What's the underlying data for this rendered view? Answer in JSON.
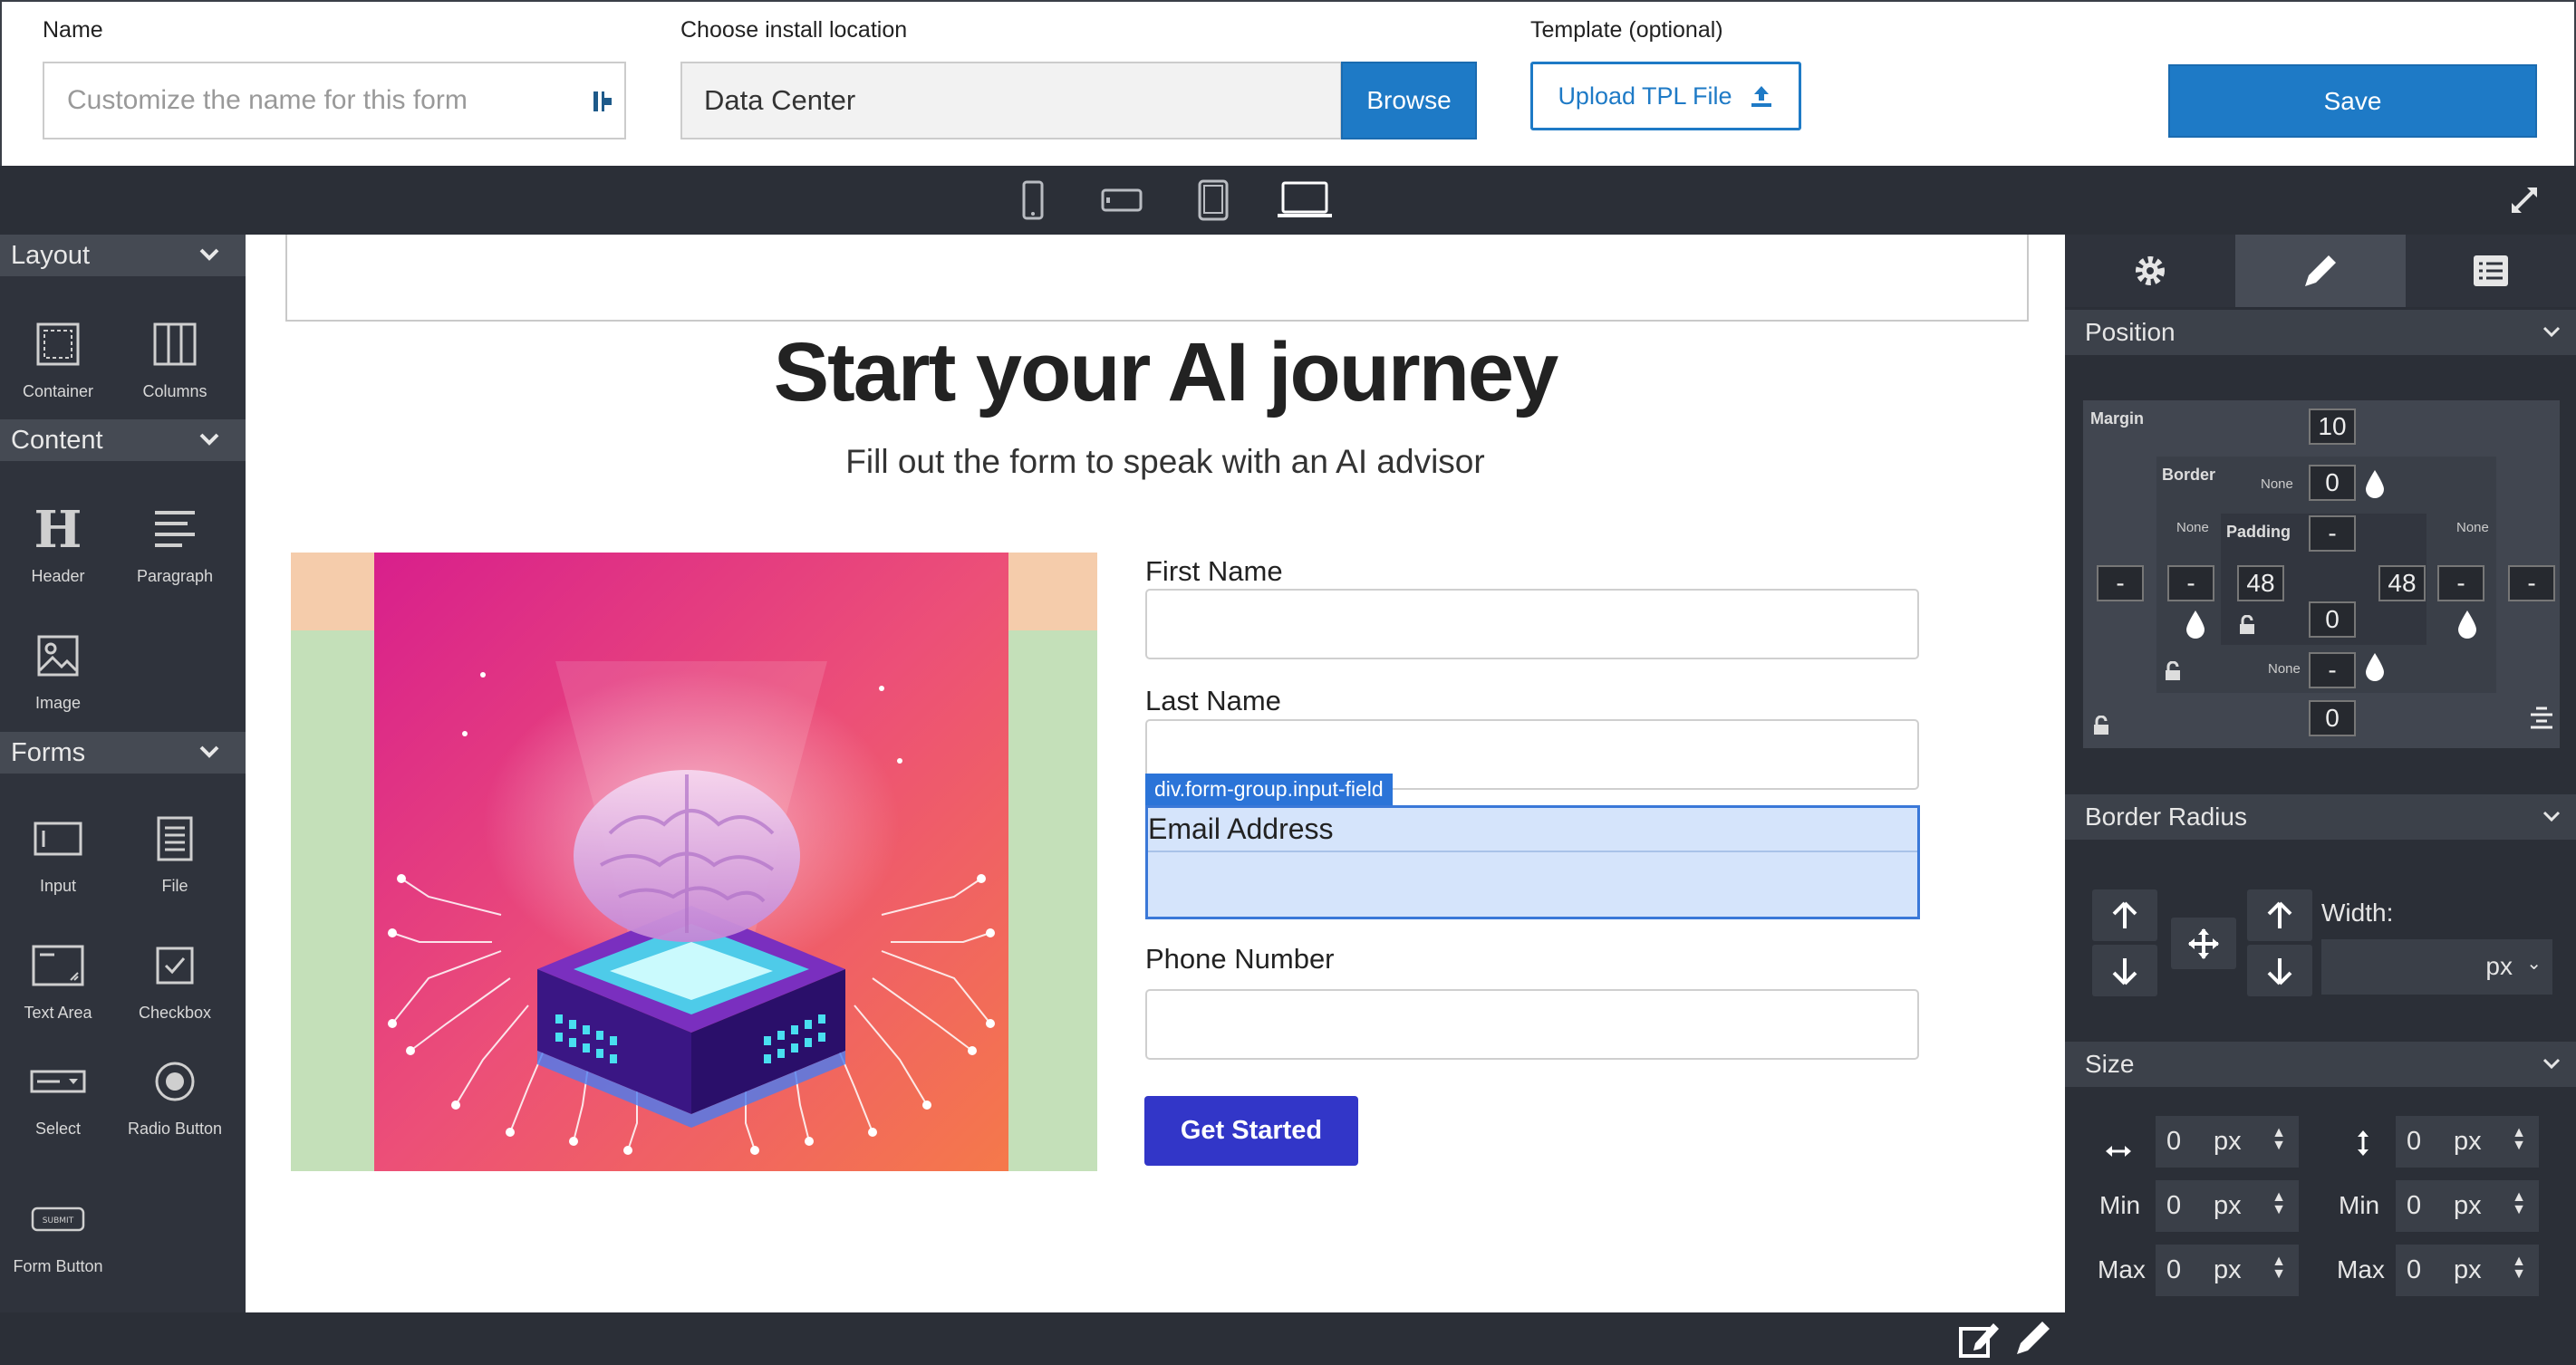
{
  "header": {
    "name_label": "Name",
    "name_placeholder": "Customize the name for this form",
    "location_label": "Choose install location",
    "location_value": "Data Center",
    "browse_label": "Browse",
    "template_label": "Template (optional)",
    "upload_label": "Upload TPL File",
    "save_label": "Save"
  },
  "sidebar": {
    "layout": {
      "title": "Layout",
      "items": [
        "Container",
        "Columns"
      ]
    },
    "content": {
      "title": "Content",
      "items": [
        "Header",
        "Paragraph",
        "Image"
      ]
    },
    "forms": {
      "title": "Forms",
      "items": [
        "Input",
        "File",
        "Text Area",
        "Checkbox",
        "Select",
        "Radio Button",
        "Form Button"
      ]
    }
  },
  "canvas": {
    "title": "Start your AI journey",
    "subtitle": "Fill out the form to speak with an AI advisor",
    "fields": [
      "First Name",
      "Last Name",
      "Email Address",
      "Phone Number"
    ],
    "selected_tag": "div.form-group.input-field",
    "cta_label": "Get Started"
  },
  "right_panel": {
    "position": {
      "title": "Position",
      "margin_label": "Margin",
      "border_label": "Border",
      "padding_label": "Padding",
      "none_label": "None",
      "margin_top": "10",
      "margin_bottom": "0",
      "margin_left": "-",
      "margin_right": "-",
      "border_top": "0",
      "border_bottom": "-",
      "border_left": "-",
      "border_right": "-",
      "padding_top": "-",
      "padding_bottom": "0",
      "padding_left": "48",
      "padding_right": "48"
    },
    "border_radius": {
      "title": "Border Radius",
      "width_label": "Width:",
      "unit": "px"
    },
    "size": {
      "title": "Size",
      "min_label": "Min",
      "max_label": "Max",
      "unit": "px",
      "width": "0",
      "height": "0",
      "min_width": "0",
      "min_height": "0",
      "max_width": "0",
      "max_height": "0"
    }
  },
  "colors": {
    "accent": "#1e7ac6",
    "cta": "#3236c8",
    "selection": "#3a78d8",
    "panel_bg": "#2b2f37"
  }
}
